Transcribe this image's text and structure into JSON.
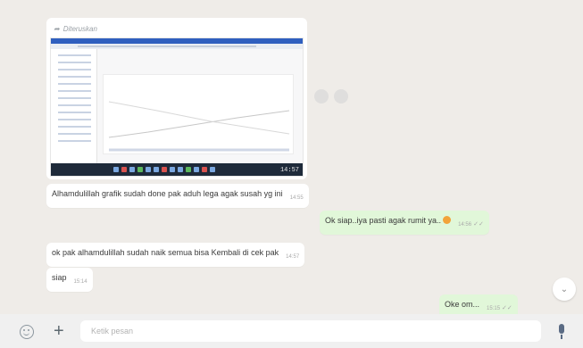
{
  "forwarded_label": "Diteruskan",
  "screenshot": {
    "clock": "14:57"
  },
  "messages": [
    {
      "dir": "in",
      "text": "Alhamdulillah grafik sudah done pak aduh lega agak susah yg ini",
      "time": "14:55"
    },
    {
      "dir": "out",
      "text": "Ok siap..iya pasti agak rumit ya..",
      "time": "14:56"
    },
    {
      "dir": "in",
      "text": "ok pak alhamdulillah sudah naik semua bisa Kembali di cek pak",
      "time": "14:57"
    },
    {
      "dir": "in",
      "text": "siap",
      "time": "15:14"
    },
    {
      "dir": "out",
      "text": "Oke om...",
      "time": "15:15"
    }
  ],
  "composer": {
    "placeholder": "Ketik pesan"
  },
  "icons": {
    "emoji": "smiley-icon",
    "attach": "plus-icon",
    "mic": "microphone-icon",
    "scroll": "chevron-down-icon"
  },
  "colors": {
    "incoming": "#ffffff",
    "outgoing": "#e1f7d9",
    "background": "#efece8"
  }
}
